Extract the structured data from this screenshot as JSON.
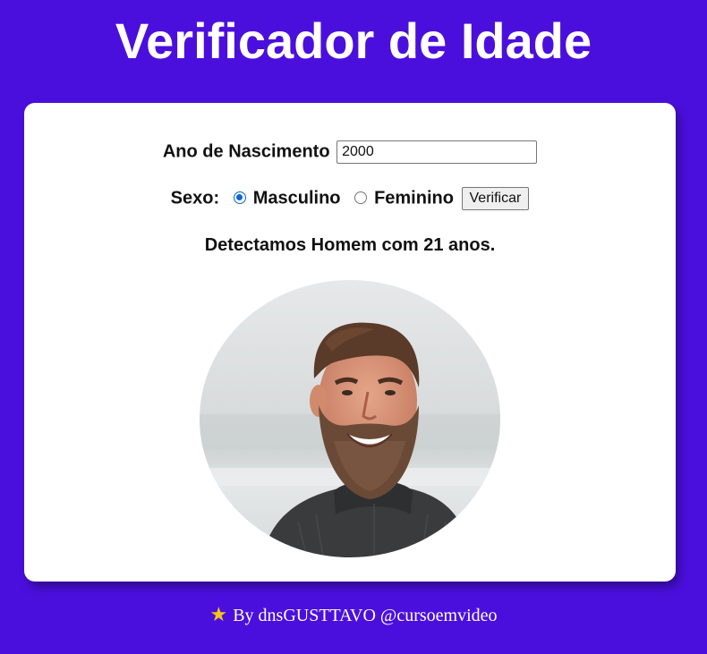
{
  "page": {
    "title": "Verificador de Idade"
  },
  "form": {
    "birth_year_label": "Ano de Nascimento",
    "birth_year_value": "2000",
    "sex_label": "Sexo:",
    "sex_options": [
      "Masculino",
      "Feminino"
    ],
    "selected_sex": "Masculino",
    "verify_button": "Verificar"
  },
  "result": {
    "text": "Detectamos Homem com 21 anos.",
    "image_icon": "bearded-man-photo"
  },
  "footer": {
    "icon": "star-icon",
    "text": "By dnsGUSTTAVO @cursoemvideo"
  },
  "colors": {
    "background": "#4b0fdd",
    "card": "#ffffff",
    "radio_accent": "#0a66d8",
    "star": "#f5c518"
  }
}
